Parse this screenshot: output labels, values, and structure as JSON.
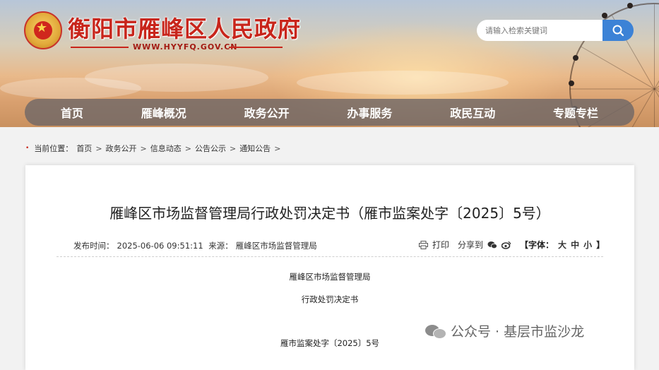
{
  "header": {
    "site_title": "衡阳市雁峰区人民政府",
    "site_url": "WWW.HYYFQ.GOV.CN",
    "emblem": "national-emblem",
    "search": {
      "placeholder": "请输入检索关键词",
      "button_icon": "search-icon"
    }
  },
  "nav": {
    "items": [
      {
        "label": "首页"
      },
      {
        "label": "雁峰概况"
      },
      {
        "label": "政务公开"
      },
      {
        "label": "办事服务"
      },
      {
        "label": "政民互动"
      },
      {
        "label": "专题专栏"
      }
    ]
  },
  "breadcrumb": {
    "prefix": "当前位置：",
    "items": [
      "首页",
      "政务公开",
      "信息动态",
      "公告公示",
      "通知公告"
    ],
    "separator": ">"
  },
  "article": {
    "title": "雁峰区市场监督管理局行政处罚决定书（雁市监案处字〔2025〕5号）",
    "publish_label": "发布时间：",
    "publish_time": "2025-06-06 09:51:11",
    "source_label": "来源：",
    "source": "雁峰区市场监督管理局",
    "tools": {
      "print": "打印",
      "share": "分享到",
      "font_label": "【字体：",
      "font_large": "大",
      "font_medium": "中",
      "font_small": "小",
      "font_close": "】"
    },
    "lines": [
      "雁峰区市场监督管理局",
      "行政处罚决定书",
      "雁市监案处字〔2025〕5号"
    ]
  },
  "watermark": {
    "text": "公众号 · 基层市监沙龙"
  },
  "colors": {
    "brand_red": "#c8251b",
    "search_blue": "#3c82d6",
    "nav_bg": "#706866"
  }
}
